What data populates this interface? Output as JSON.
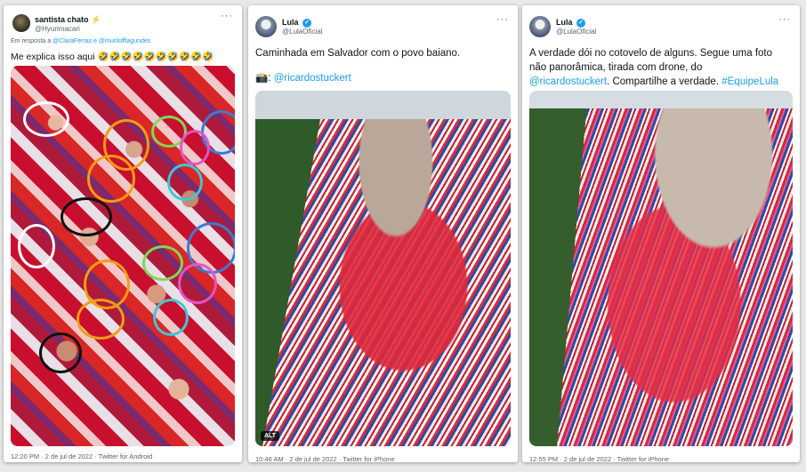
{
  "tweets": [
    {
      "display_name": "santista chato",
      "name_emoji": "⚡",
      "handle": "@Hyurimacari",
      "reply_to_prefix": "Em resposta a",
      "reply_to_users": "@ClaraFerras e @murilofflagundes",
      "text": "Me explica isso aqui",
      "text_emoji": "🤣🤣🤣🤣🤣🤣🤣🤣🤣🤣",
      "timestamp": "12:20 PM · 2 de jul de 2022 · Twitter for Android",
      "more_label": "···"
    },
    {
      "display_name": "Lula",
      "verified": true,
      "handle": "@LulaOficial",
      "text": "Caminhada em Salvador com o povo baiano.",
      "camera_emoji": "📸",
      "text2_prefix": ": ",
      "mention": "@ricardostuckert",
      "alt_label": "ALT",
      "timestamp": "10:46 AM · 2 de jul de 2022 · Twitter for iPhone",
      "more_label": "···"
    },
    {
      "display_name": "Lula",
      "verified": true,
      "handle": "@LulaOficial",
      "text_line1": "A verdade dói no cotovelo de alguns. Segue uma foto",
      "text_line2": "não panorâmica, tirada com drone, do",
      "mention": "@ricardostuckert",
      "text_line3_mid": ". Compartilhe a verdade.",
      "hashtag": "#EquipeLula",
      "timestamp": "12:55 PM · 2 de jul de 2022 · Twitter for iPhone",
      "more_label": "···"
    }
  ],
  "colors": {
    "link": "#1d9bf0",
    "circle_white": "#ffffff",
    "circle_orange": "#f39c12",
    "circle_green": "#7ed957",
    "circle_blue": "#3b7bd6",
    "circle_pink": "#e056c8",
    "circle_cyan": "#3fc6d6",
    "circle_black": "#111111"
  }
}
